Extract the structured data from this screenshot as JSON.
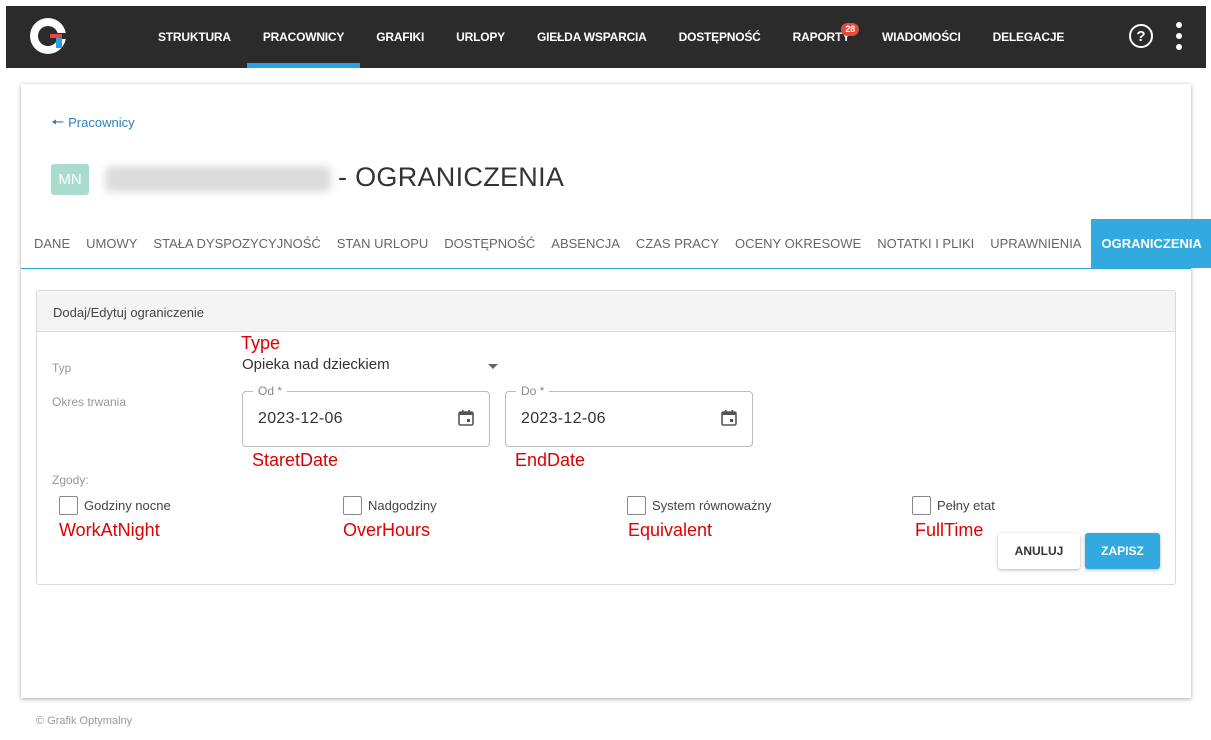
{
  "nav": {
    "items": [
      {
        "label": "STRUKTURA"
      },
      {
        "label": "PRACOWNICY",
        "active": true
      },
      {
        "label": "GRAFIKI"
      },
      {
        "label": "URLOPY"
      },
      {
        "label": "GIEŁDA WSPARCIA"
      },
      {
        "label": "DOSTĘPNOŚĆ"
      },
      {
        "label": "RAPORTY",
        "badge": "28"
      },
      {
        "label": "WIADOMOŚCI"
      },
      {
        "label": "DELEGACJE"
      }
    ],
    "help_label": "?",
    "accent_color": "#29a3df",
    "badge_color": "#e8493f"
  },
  "breadcrumb": {
    "label": "Pracownicy"
  },
  "employee": {
    "initials": "MN",
    "title_suffix": "- OGRANICZENIA"
  },
  "tabs": [
    {
      "label": "DANE"
    },
    {
      "label": "UMOWY"
    },
    {
      "label": "STAŁA DYSPOZYCYJNOŚĆ"
    },
    {
      "label": "STAN URLOPU"
    },
    {
      "label": "DOSTĘPNOŚĆ"
    },
    {
      "label": "ABSENCJA"
    },
    {
      "label": "CZAS PRACY"
    },
    {
      "label": "OCENY OKRESOWE"
    },
    {
      "label": "NOTATKI I PLIKI"
    },
    {
      "label": "UPRAWNIENIA"
    },
    {
      "label": "OGRANICZENIA",
      "active": true
    }
  ],
  "form": {
    "header": "Dodaj/Edytuj ograniczenie",
    "type_label": "Typ",
    "type_value": "Opieka nad dzieckiem",
    "period_label": "Okres trwania",
    "from_legend": "Od *",
    "from_value": "2023-12-06",
    "to_legend": "Do *",
    "to_value": "2023-12-06",
    "consents_label": "Zgody:",
    "checkboxes": [
      {
        "label": "Godziny nocne",
        "checked": false
      },
      {
        "label": "Nadgodziny",
        "checked": false
      },
      {
        "label": "System równoważny",
        "checked": false
      },
      {
        "label": "Pełny etat",
        "checked": false
      }
    ],
    "cancel_label": "ANULUJ",
    "save_label": "ZAPISZ"
  },
  "annotations": {
    "type": "Type",
    "start": "StaretDate",
    "end": "EndDate",
    "work_at_night": "WorkAtNight",
    "over_hours": "OverHours",
    "equivalent": "Equivalent",
    "full_time": "FullTime"
  },
  "footer": {
    "text": "© Grafik Optymalny"
  }
}
